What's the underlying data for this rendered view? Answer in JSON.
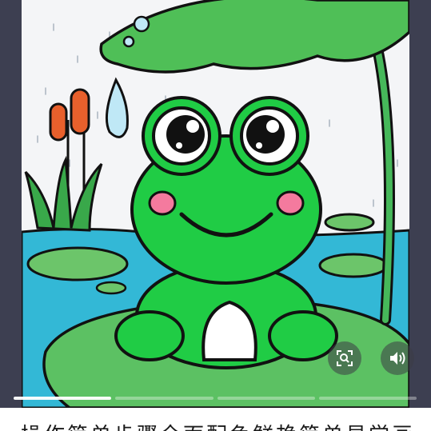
{
  "viewer": {
    "colors": {
      "background": "#3d3f51",
      "water": "#33b8d6",
      "frog": "#20cc45",
      "leaf": "#5cc163",
      "cheeks": "#f47a9e"
    },
    "buttons": [
      {
        "name": "scan-button",
        "icon": "scan-icon"
      },
      {
        "name": "sound-button",
        "icon": "speaker-icon"
      }
    ],
    "progress": {
      "segments": 4,
      "active_index": 0
    }
  },
  "caption": {
    "text": "操作简单步骤全面配色鲜艳简单易学画"
  }
}
